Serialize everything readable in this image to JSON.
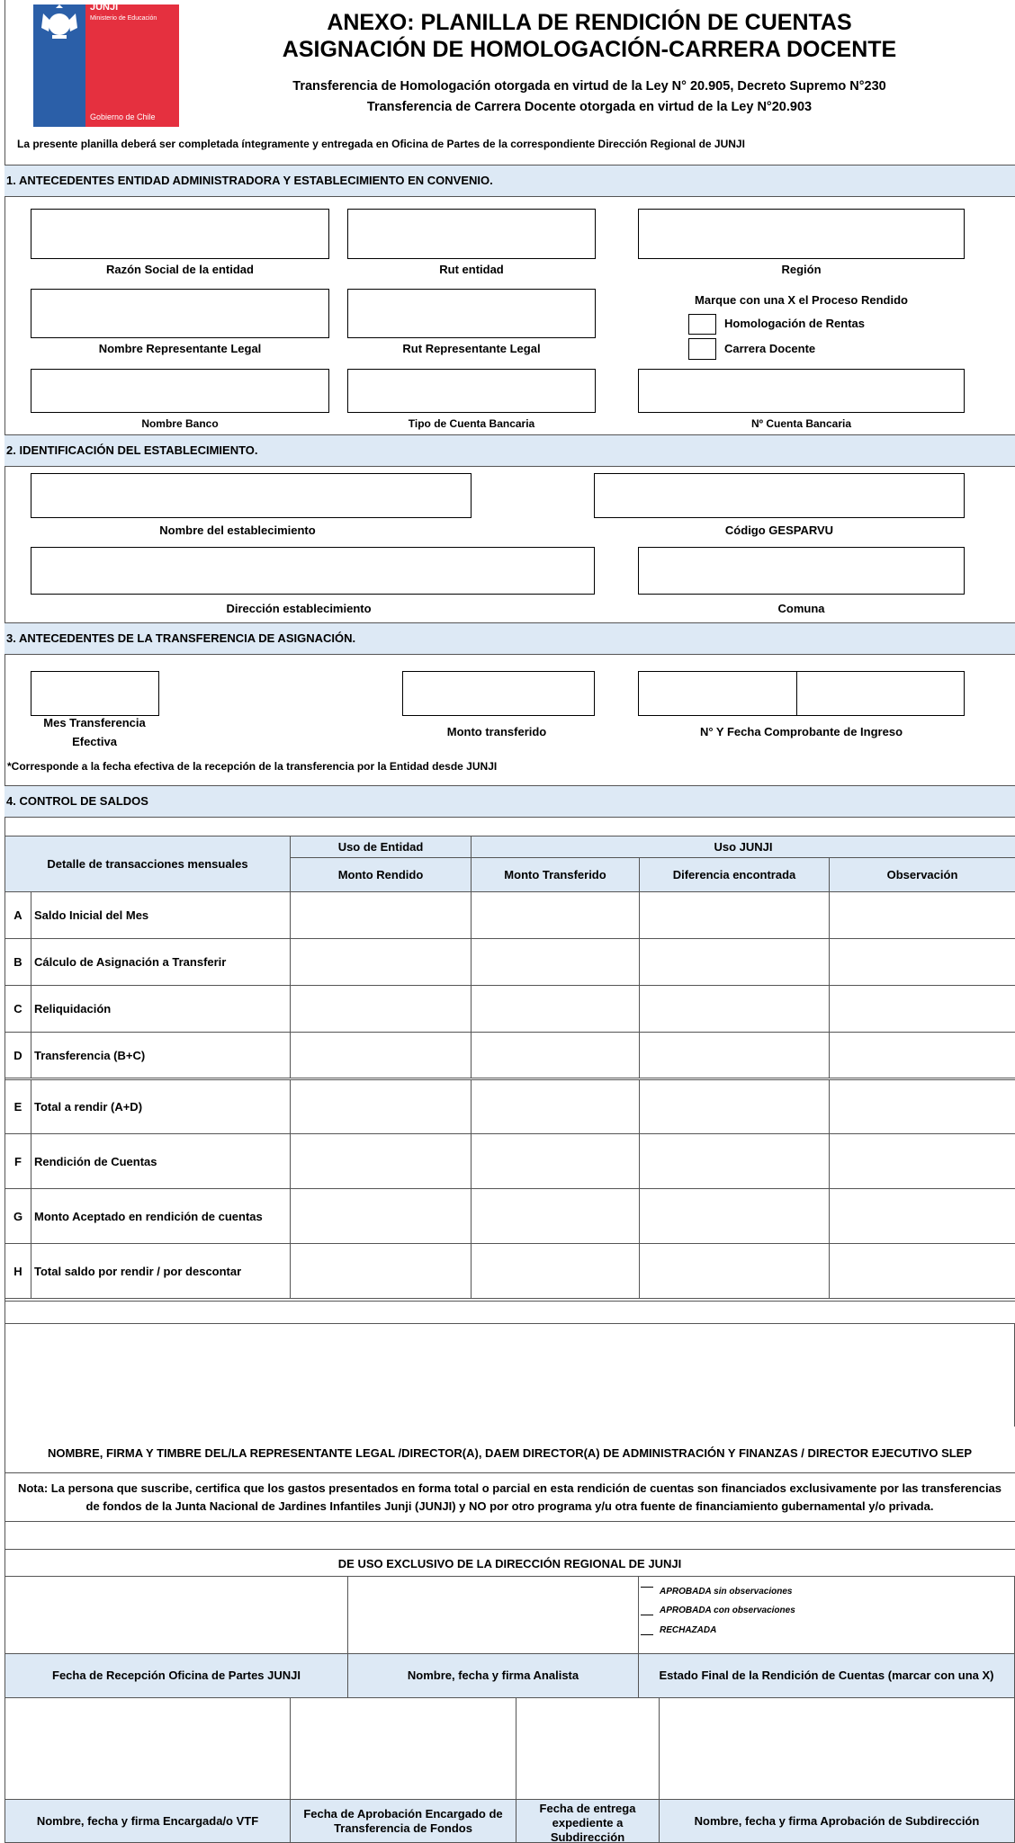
{
  "logo": {
    "org": "JUNJI",
    "ministry": "Ministerio de Educación",
    "government": "Gobierno de Chile"
  },
  "header": {
    "title_line1": "ANEXO: PLANILLA DE RENDICIÓN DE CUENTAS",
    "title_line2": "ASIGNACIÓN DE HOMOLOGACIÓN-CARRERA DOCENTE",
    "subtitle_line1": "Transferencia de Homologación otorgada en virtud de la Ley N° 20.905, Decreto Supremo N°230",
    "subtitle_line2": "Transferencia de Carrera Docente otorgada en virtud de la Ley N°20.903",
    "instruction": "La presente planilla deberá ser completada íntegramente y entregada en Oficina de Partes de la correspondiente Dirección Regional de JUNJI"
  },
  "section1": {
    "title": "1. ANTECEDENTES ENTIDAD ADMINISTRADORA Y ESTABLECIMIENTO EN CONVENIO.",
    "razon_social": "Razón Social de la entidad",
    "rut_entidad": "Rut entidad",
    "region": "Región",
    "nombre_rep": "Nombre Representante Legal",
    "rut_rep": "Rut Representante Legal",
    "marque": "Marque con una X el Proceso Rendido",
    "opt_homologacion": "Homologación de Rentas",
    "opt_carrera": "Carrera Docente",
    "nombre_banco": "Nombre Banco",
    "tipo_cuenta": "Tipo de Cuenta Bancaria",
    "num_cuenta": "Nº  Cuenta Bancaria"
  },
  "section2": {
    "title": "2. IDENTIFICACIÓN DEL ESTABLECIMIENTO.",
    "nombre_est": "Nombre del establecimiento",
    "codigo": "Código GESPARVU",
    "direccion": "Dirección establecimiento",
    "comuna": "Comuna"
  },
  "section3": {
    "title": "3. ANTECEDENTES DE LA TRANSFERENCIA DE ASIGNACIÓN.",
    "mes_line1": "Mes Transferencia",
    "mes_line2": "Efectiva",
    "monto": "Monto transferido",
    "comprobante": "N° Y Fecha Comprobante de Ingreso",
    "note": "*Corresponde a la fecha efectiva de la recepción de la transferencia por la Entidad desde JUNJI"
  },
  "section4": {
    "title": "4. CONTROL DE SALDOS",
    "detalle": "Detalle de transacciones mensuales",
    "uso_entidad": "Uso de Entidad",
    "uso_junji": "Uso JUNJI",
    "monto_rendido": "Monto Rendido",
    "monto_transferido": "Monto Transferido",
    "diferencia": "Diferencia encontrada",
    "observacion": "Observación",
    "rows": [
      {
        "letter": "A",
        "label": "Saldo Inicial del Mes"
      },
      {
        "letter": "B",
        "label": "Cálculo de Asignación a Transferir"
      },
      {
        "letter": "C",
        "label": "Reliquidación"
      },
      {
        "letter": "D",
        "label": "Transferencia (B+C)"
      },
      {
        "letter": "E",
        "label": "Total a rendir (A+D)"
      },
      {
        "letter": "F",
        "label": "Rendición de Cuentas"
      },
      {
        "letter": "G",
        "label": "Monto Aceptado en rendición de cuentas"
      },
      {
        "letter": "H",
        "label": "Total saldo por rendir / por descontar"
      }
    ]
  },
  "signature": {
    "firma": "NOMBRE, FIRMA Y TIMBRE DEL/LA REPRESENTANTE LEGAL /DIRECTOR(A), DAEM DIRECTOR(A) DE ADMINISTRACIÓN Y FINANZAS / DIRECTOR EJECUTIVO SLEP",
    "nota_line1": "Nota: La persona que suscribe, certifica que los gastos presentados en forma total o parcial en esta rendición de cuentas son financiados exclusivamente por las transferencias",
    "nota_line2": "de fondos de la Junta Nacional de Jardines Infantiles Junji (JUNJI) y NO por otro programa y/u otra fuente de financiamiento gubernamental y/o privada."
  },
  "exclusive": {
    "title": "DE USO EXCLUSIVO DE LA DIRECCIÓN REGIONAL DE JUNJI",
    "status_aprobada_sin": "APROBADA sin observaciones",
    "status_aprobada_con": "APROBADA con observaciones",
    "status_rechazada": "RECHAZADA",
    "fecha_recepcion": "Fecha de Recepción Oficina de Partes JUNJI",
    "analista": "Nombre, fecha y firma Analista",
    "estado_final": "Estado Final de la Rendición de Cuentas (marcar con una X)",
    "encargada_vtf": "Nombre, fecha y firma  Encargada/o VTF",
    "fecha_aprobacion_line1": "Fecha de Aprobación Encargado de",
    "fecha_aprobacion_line2": "Transferencia de Fondos",
    "fecha_entrega_line1": "Fecha de entrega",
    "fecha_entrega_line2": "expediente a",
    "fecha_entrega_line3": "Subdirección",
    "subdireccion": "Nombre, fecha y firma Aprobación de Subdirección"
  }
}
